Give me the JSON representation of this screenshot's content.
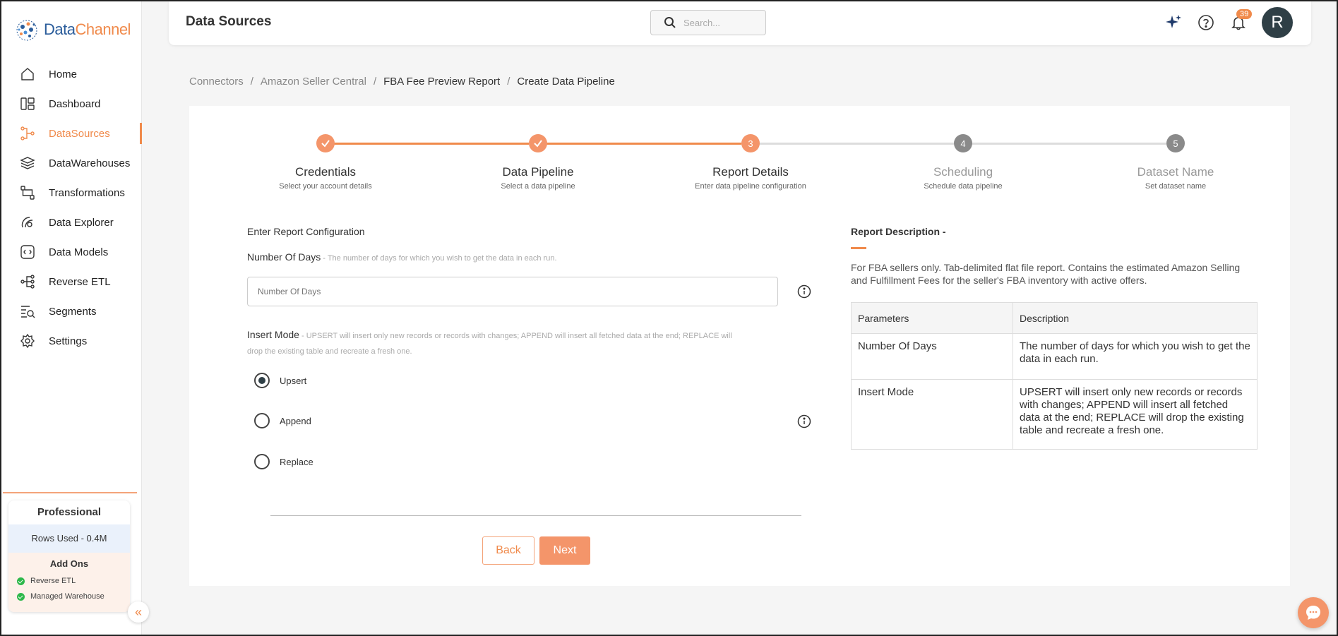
{
  "app": {
    "logo_part1": "Data",
    "logo_part2": "Channel"
  },
  "sidebar": {
    "items": [
      {
        "label": "Home",
        "icon": "home-icon"
      },
      {
        "label": "Dashboard",
        "icon": "dashboard-icon"
      },
      {
        "label": "DataSources",
        "icon": "datasources-icon",
        "active": true
      },
      {
        "label": "DataWarehouses",
        "icon": "layers-icon"
      },
      {
        "label": "Transformations",
        "icon": "transform-icon"
      },
      {
        "label": "Data Explorer",
        "icon": "explorer-icon"
      },
      {
        "label": "Data Models",
        "icon": "models-icon"
      },
      {
        "label": "Reverse ETL",
        "icon": "reverse-etl-icon"
      },
      {
        "label": "Segments",
        "icon": "segments-icon"
      },
      {
        "label": "Settings",
        "icon": "gear-icon"
      }
    ],
    "plan": {
      "title": "Professional",
      "rows_used": "Rows Used - 0.4M",
      "addons_title": "Add Ons",
      "addons": [
        "Reverse ETL",
        "Managed Warehouse"
      ]
    }
  },
  "header": {
    "title": "Data Sources",
    "search_placeholder": "Search...",
    "notification_count": "39",
    "avatar_initial": "R"
  },
  "breadcrumb": [
    "Connectors",
    "Amazon Seller Central",
    "FBA Fee Preview Report",
    "Create Data Pipeline"
  ],
  "stepper": [
    {
      "label": "Credentials",
      "sub": "Select your account details",
      "state": "done",
      "num": "1"
    },
    {
      "label": "Data Pipeline",
      "sub": "Select a data pipeline",
      "state": "done",
      "num": "2"
    },
    {
      "label": "Report Details",
      "sub": "Enter data pipeline configuration",
      "state": "current",
      "num": "3"
    },
    {
      "label": "Scheduling",
      "sub": "Schedule data pipeline",
      "state": "todo",
      "num": "4"
    },
    {
      "label": "Dataset Name",
      "sub": "Set dataset name",
      "state": "todo",
      "num": "5"
    }
  ],
  "form": {
    "section_title": "Enter Report Configuration",
    "days_label": "Number Of Days",
    "days_hint": " - The number of days for which you wish to get the data in each run.",
    "days_placeholder": "Number Of Days",
    "insert_label": "Insert Mode",
    "insert_hint": " - UPSERT will insert only new records or records with changes; APPEND will insert all fetched data at the end; REPLACE will drop the existing table and recreate a fresh one.",
    "options": [
      "Upsert",
      "Append",
      "Replace"
    ],
    "selected": "Upsert",
    "back_label": "Back",
    "next_label": "Next"
  },
  "description": {
    "title": "Report Description -",
    "text": "For FBA sellers only. Tab-delimited flat file report. Contains the estimated Amazon Selling and Fulfillment Fees for the seller's FBA inventory with active offers.",
    "table_headers": [
      "Parameters",
      "Description"
    ],
    "rows": [
      [
        "Number Of Days",
        "The number of days for which you wish to get the data in each run."
      ],
      [
        "Insert Mode",
        "UPSERT will insert only new records or records with changes; APPEND will insert all fetched data at the end; REPLACE will drop the existing table and recreate a fresh one."
      ]
    ]
  },
  "colors": {
    "accent": "#f08a4b",
    "brand_blue": "#2b5d9b",
    "avatar_bg": "#2f3f46",
    "step_todo": "#8a8a8a"
  }
}
